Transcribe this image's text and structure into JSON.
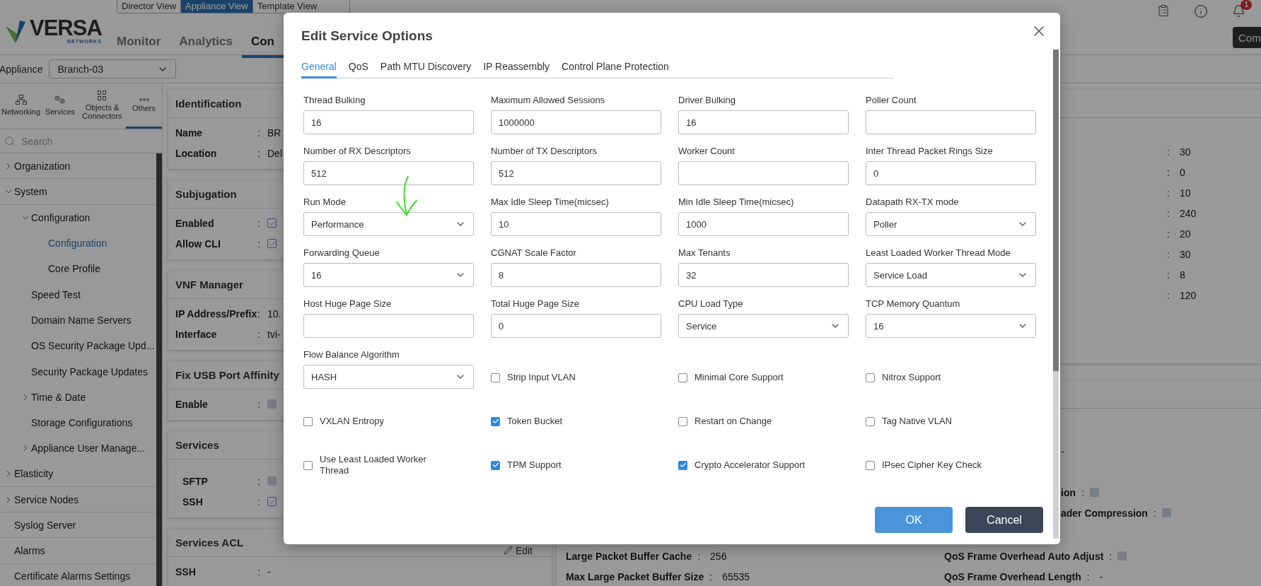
{
  "header": {
    "logo": {
      "name": "VERSA",
      "sub": "NETWORKS"
    },
    "views": [
      {
        "label": "Director View",
        "selected": false
      },
      {
        "label": "Appliance View",
        "selected": true
      },
      {
        "label": "Template View",
        "selected": false
      }
    ],
    "nav": [
      {
        "label": "Monitor",
        "selected": false
      },
      {
        "label": "Analytics",
        "selected": false
      },
      {
        "label": "Con",
        "selected": true
      }
    ],
    "notification_count": "1",
    "action_button": "Com"
  },
  "appliance": {
    "label": "Appliance",
    "value": "Branch-03"
  },
  "sidebar": {
    "tabs": [
      {
        "label": "Networking",
        "kind": "network",
        "selected": false
      },
      {
        "label": "Services",
        "kind": "gears",
        "selected": false
      },
      {
        "label": "Objects & Connectors",
        "kind": "objects",
        "selected": false
      },
      {
        "label": "Others",
        "kind": "dots",
        "selected": true
      }
    ],
    "search": {
      "placeholder": "Search"
    },
    "tree": [
      {
        "label": "Organization",
        "expanded": false,
        "selected": false
      },
      {
        "label": "System",
        "expanded": true,
        "selected": false,
        "children": [
          {
            "label": "Configuration",
            "expanded": true,
            "selected": false,
            "children": [
              {
                "label": "Configuration",
                "selected": true
              },
              {
                "label": "Core Profile",
                "selected": false
              }
            ]
          },
          {
            "label": "Speed Test",
            "selected": false
          },
          {
            "label": "Domain Name Servers",
            "selected": false
          },
          {
            "label": "OS Security Package Upd...",
            "selected": false
          },
          {
            "label": "Security Package Updates",
            "selected": false
          },
          {
            "label": "Time & Date",
            "expanded": false,
            "selected": false
          },
          {
            "label": "Storage Configurations",
            "selected": false
          },
          {
            "label": "Appliance User Manage...",
            "expanded": false,
            "selected": false
          }
        ]
      },
      {
        "label": "Elasticity",
        "expanded": false,
        "selected": false
      },
      {
        "label": "Service Nodes",
        "expanded": false,
        "selected": false
      },
      {
        "label": "Syslog Server",
        "selected": false
      },
      {
        "label": "Alarms",
        "selected": false
      },
      {
        "label": "Certificate Alarms Settings",
        "selected": false
      }
    ]
  },
  "cards": [
    {
      "title": "Identification",
      "indented": false,
      "rows": [
        {
          "label": "Name",
          "separator": ":",
          "kind": "text",
          "value": "BR"
        },
        {
          "label": "Location",
          "separator": ":",
          "kind": "text",
          "value": "Del"
        }
      ]
    },
    {
      "title": "Subjugation",
      "indented": false,
      "rows": [
        {
          "label": "Enabled",
          "separator": ":",
          "kind": "checkbox",
          "checked": true
        },
        {
          "label": "Allow CLI",
          "separator": ":",
          "kind": "checkbox",
          "checked": true
        }
      ]
    },
    {
      "title": "VNF Manager",
      "indented": false,
      "rows": [
        {
          "label": "IP Address/Prefix",
          "separator": ":",
          "kind": "text",
          "value": "10."
        },
        {
          "label": "Interface",
          "separator": ":",
          "kind": "text",
          "value": "tvi-"
        }
      ]
    },
    {
      "title": "Fix USB Port Affinity",
      "indented": false,
      "rows": [
        {
          "label": "Enable",
          "separator": ":",
          "kind": "checkbox",
          "checked": false
        }
      ]
    },
    {
      "title": "Services",
      "indented": true,
      "rows": [
        {
          "label": "SFTP",
          "separator": ":",
          "kind": "checkbox",
          "checked": false
        },
        {
          "label": "SSH",
          "separator": ":",
          "kind": "checkbox",
          "checked": true
        }
      ]
    },
    {
      "title": "Services ACL",
      "indented": false,
      "action": "Edit",
      "rows": [
        {
          "label": "SSH",
          "separator": ":",
          "kind": "text",
          "value": "-"
        }
      ]
    }
  ],
  "right_panel": {
    "values": [
      {
        "separator": ":",
        "value": "30"
      },
      {
        "separator": ":",
        "value": "0"
      },
      {
        "separator": ":",
        "value": "10"
      },
      {
        "separator": ":",
        "value": "240"
      },
      {
        "separator": ":",
        "value": "20"
      },
      {
        "separator": ":",
        "value": "30"
      },
      {
        "separator": ":",
        "value": "8"
      },
      {
        "separator": ":",
        "value": "120"
      }
    ],
    "partial_rows": [
      {
        "kind": "text",
        "value": "-"
      },
      {
        "kind": "blank"
      },
      {
        "kind": "checkbox",
        "label": "ion",
        "separator": ":",
        "checked": false
      },
      {
        "kind": "checkbox",
        "label": "ader Compression",
        "separator": ":",
        "checked": false
      }
    ],
    "rows": [
      [
        {
          "kind": "text",
          "label": "Large Packet Buffer Cache",
          "separator": ":",
          "value": "256"
        },
        {
          "kind": "checkbox",
          "label": "QoS Frame Overhead Auto Adjust",
          "separator": ":",
          "checked": false
        }
      ],
      [
        {
          "kind": "text",
          "label": "Max Large Packet Buffer Size",
          "separator": ":",
          "value": "65535"
        },
        {
          "kind": "text",
          "label": "QoS Frame Overhead Length",
          "separator": ":",
          "value": "-"
        }
      ]
    ]
  },
  "dialog": {
    "title": "Edit Service Options",
    "tabs": [
      {
        "label": "General",
        "selected": true
      },
      {
        "label": "QoS",
        "selected": false
      },
      {
        "label": "Path MTU Discovery",
        "selected": false
      },
      {
        "label": "IP Reassembly",
        "selected": false
      },
      {
        "label": "Control Plane Protection",
        "selected": false
      }
    ],
    "fields": [
      {
        "kind": "text",
        "label": "Thread Bulking",
        "value": "16"
      },
      {
        "kind": "text",
        "label": "Maximum Allowed Sessions",
        "value": "1000000"
      },
      {
        "kind": "text",
        "label": "Driver Bulking",
        "value": "16"
      },
      {
        "kind": "text",
        "label": "Poller Count"
      },
      {
        "kind": "text",
        "label": "Number of RX Descriptors",
        "value": "512"
      },
      {
        "kind": "text",
        "label": "Number of TX Descriptors",
        "value": "512"
      },
      {
        "kind": "text",
        "label": "Worker Count"
      },
      {
        "kind": "text",
        "label": "Inter Thread Packet Rings Size",
        "value": "0"
      },
      {
        "kind": "select",
        "label": "Run Mode",
        "value": "Performance"
      },
      {
        "kind": "text",
        "label": "Max Idle Sleep Time(micsec)",
        "value": "10"
      },
      {
        "kind": "text",
        "label": "Min Idle Sleep Time(micsec)",
        "value": "1000"
      },
      {
        "kind": "select",
        "label": "Datapath RX-TX mode",
        "value": "Poller"
      },
      {
        "kind": "select",
        "label": "Forwarding Queue",
        "value": "16"
      },
      {
        "kind": "text",
        "label": "CGNAT Scale Factor",
        "value": "8"
      },
      {
        "kind": "text",
        "label": "Max Tenants",
        "value": "32"
      },
      {
        "kind": "select",
        "label": "Least Loaded Worker Thread Mode",
        "value": "Service Load"
      },
      {
        "kind": "text",
        "label": "Host Huge Page Size"
      },
      {
        "kind": "text",
        "label": "Total Huge Page Size",
        "value": "0"
      },
      {
        "kind": "select",
        "label": "CPU Load Type",
        "value": "Service"
      },
      {
        "kind": "select",
        "label": "TCP Memory Quantum",
        "value": "16"
      },
      {
        "kind": "select",
        "label": "Flow Balance Algorithm",
        "value": "HASH"
      },
      {
        "kind": "checkbox",
        "label": "Strip Input VLAN",
        "checked": false
      },
      {
        "kind": "checkbox",
        "label": "Minimal Core Support",
        "checked": false
      },
      {
        "kind": "checkbox",
        "label": "Nitrox Support",
        "checked": false
      },
      {
        "kind": "checkbox",
        "label": "VXLAN Entropy",
        "checked": false
      },
      {
        "kind": "checkbox",
        "label": "Token Bucket",
        "checked": true
      },
      {
        "kind": "checkbox",
        "label": "Restart on Change",
        "checked": false
      },
      {
        "kind": "checkbox",
        "label": "Tag Native VLAN",
        "checked": false
      },
      {
        "kind": "checkbox",
        "label": "Use Least Loaded Worker Thread",
        "checked": false
      },
      {
        "kind": "checkbox",
        "label": "TPM Support",
        "checked": true
      },
      {
        "kind": "checkbox",
        "label": "Crypto Accelerator Support",
        "checked": true
      },
      {
        "kind": "checkbox",
        "label": "IPsec Cipher Key Check",
        "checked": false
      }
    ],
    "buttons": [
      {
        "label": "OK",
        "kind": "primary"
      },
      {
        "label": "Cancel",
        "kind": "secondary"
      }
    ]
  }
}
